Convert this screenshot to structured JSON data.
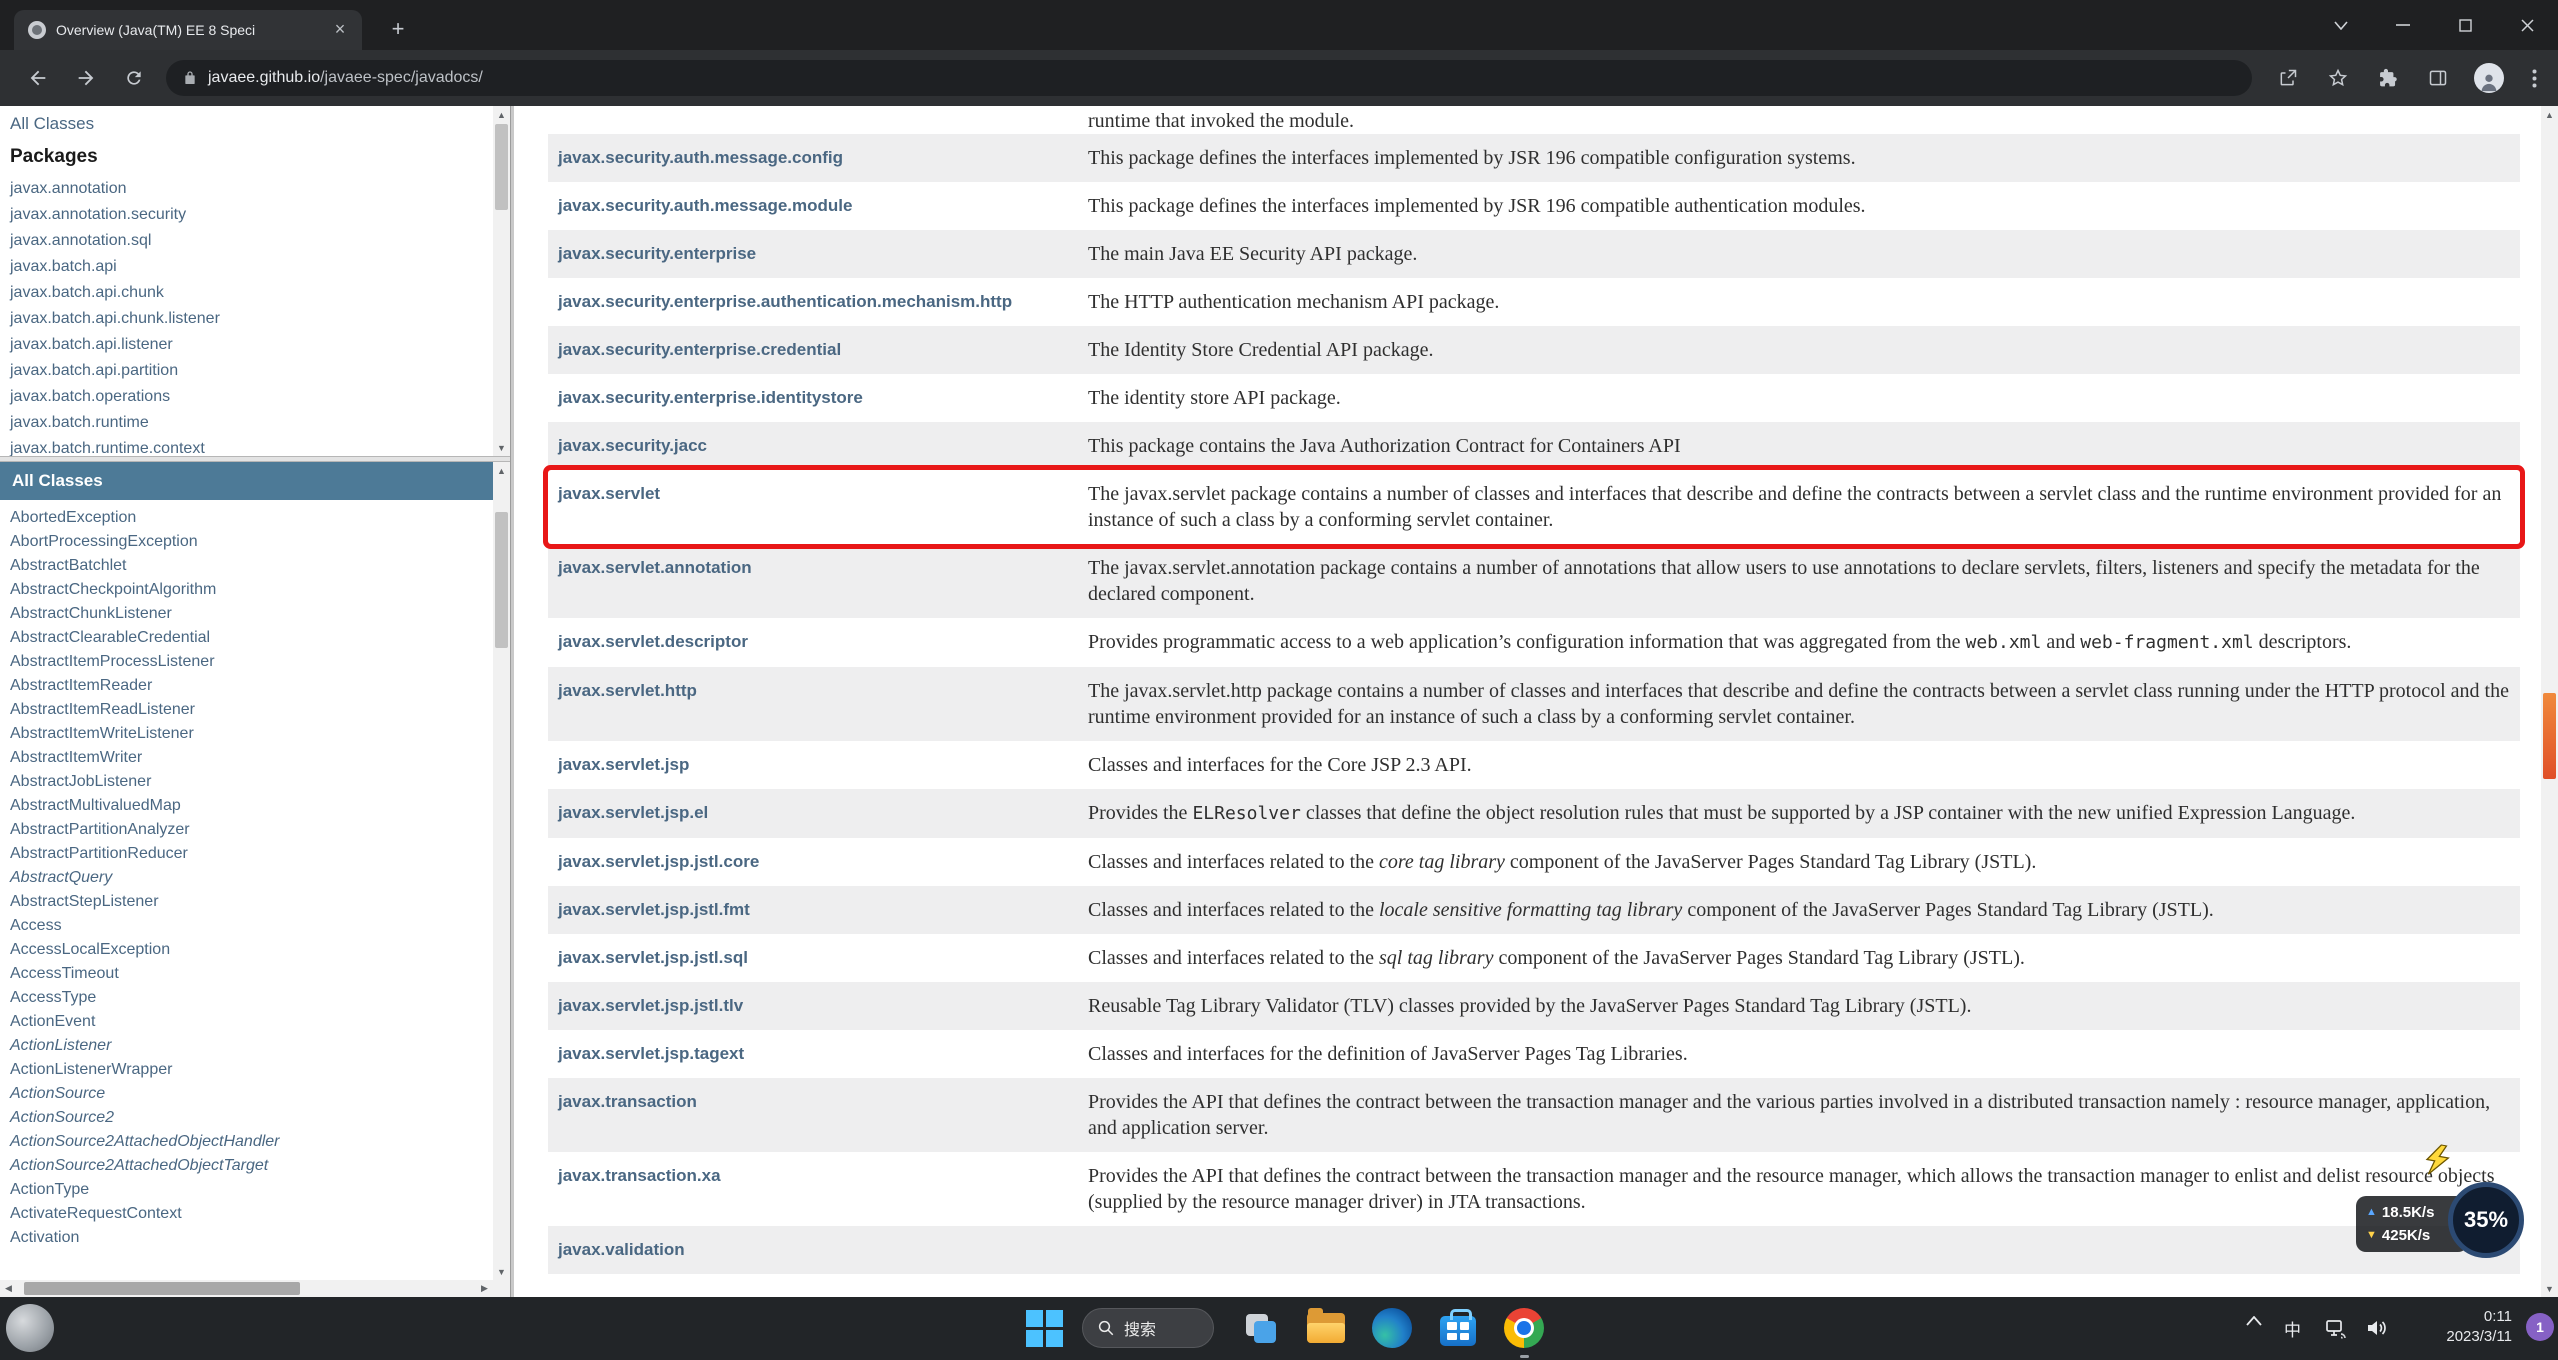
{
  "browser": {
    "tab_title": "Overview (Java(TM) EE 8 Speci",
    "url_domain": "javaee.github.io",
    "url_path": "/javaee-spec/javadocs/"
  },
  "sidebar": {
    "all_classes_link": "All Classes",
    "packages_header": "Packages",
    "packages": [
      "javax.annotation",
      "javax.annotation.security",
      "javax.annotation.sql",
      "javax.batch.api",
      "javax.batch.api.chunk",
      "javax.batch.api.chunk.listener",
      "javax.batch.api.listener",
      "javax.batch.api.partition",
      "javax.batch.operations",
      "javax.batch.runtime",
      "javax.batch.runtime.context"
    ],
    "classes_header": "All Classes",
    "classes": [
      {
        "n": "AbortedException"
      },
      {
        "n": "AbortProcessingException"
      },
      {
        "n": "AbstractBatchlet"
      },
      {
        "n": "AbstractCheckpointAlgorithm"
      },
      {
        "n": "AbstractChunkListener"
      },
      {
        "n": "AbstractClearableCredential"
      },
      {
        "n": "AbstractItemProcessListener"
      },
      {
        "n": "AbstractItemReader"
      },
      {
        "n": "AbstractItemReadListener"
      },
      {
        "n": "AbstractItemWriteListener"
      },
      {
        "n": "AbstractItemWriter"
      },
      {
        "n": "AbstractJobListener"
      },
      {
        "n": "AbstractMultivaluedMap"
      },
      {
        "n": "AbstractPartitionAnalyzer"
      },
      {
        "n": "AbstractPartitionReducer"
      },
      {
        "n": "AbstractQuery",
        "i": 1
      },
      {
        "n": "AbstractStepListener"
      },
      {
        "n": "Access"
      },
      {
        "n": "AccessLocalException"
      },
      {
        "n": "AccessTimeout"
      },
      {
        "n": "AccessType"
      },
      {
        "n": "ActionEvent"
      },
      {
        "n": "ActionListener",
        "i": 1
      },
      {
        "n": "ActionListenerWrapper"
      },
      {
        "n": "ActionSource",
        "i": 1
      },
      {
        "n": "ActionSource2",
        "i": 1
      },
      {
        "n": "ActionSource2AttachedObjectHandler",
        "i": 1
      },
      {
        "n": "ActionSource2AttachedObjectTarget",
        "i": 1
      },
      {
        "n": "ActionType"
      },
      {
        "n": "ActivateRequestContext"
      },
      {
        "n": "Activation"
      }
    ]
  },
  "main": {
    "rows": [
      {
        "pkg": "",
        "desc": "runtime that invoked the module.",
        "partial": 1
      },
      {
        "pkg": "javax.security.auth.message.config",
        "desc": "This package defines the interfaces implemented by JSR 196 compatible configuration systems."
      },
      {
        "pkg": "javax.security.auth.message.module",
        "desc": "This package defines the interfaces implemented by JSR 196 compatible authentication modules."
      },
      {
        "pkg": "javax.security.enterprise",
        "desc": "The main Java EE Security API package."
      },
      {
        "pkg": "javax.security.enterprise.authentication.mechanism.http",
        "desc": "The HTTP authentication mechanism API package."
      },
      {
        "pkg": "javax.security.enterprise.credential",
        "desc": "The Identity Store Credential API package."
      },
      {
        "pkg": "javax.security.enterprise.identitystore",
        "desc": "The identity store API package."
      },
      {
        "pkg": "javax.security.jacc",
        "desc": "This package contains the Java Authorization Contract for Containers API"
      },
      {
        "pkg": "javax.servlet",
        "highlight": 1,
        "desc": "The javax.servlet package contains a number of classes and interfaces that describe and define the contracts between a servlet class and the runtime environment provided for an instance of such a class by a conforming servlet container."
      },
      {
        "pkg": "javax.servlet.annotation",
        "desc": "The javax.servlet.annotation package contains a number of annotations that allow users to use annotations to declare servlets, filters, listeners and specify the metadata for the declared component."
      },
      {
        "pkg": "javax.servlet.descriptor",
        "desc": [
          {
            "t": "Provides programmatic access to a web application’s configuration information that was aggregated from the "
          },
          {
            "t": "web.xml",
            "s": "code"
          },
          {
            "t": " and "
          },
          {
            "t": "web-fragment.xml",
            "s": "code"
          },
          {
            "t": " descriptors."
          }
        ]
      },
      {
        "pkg": "javax.servlet.http",
        "desc": "The javax.servlet.http package contains a number of classes and interfaces that describe and define the contracts between a servlet class running under the HTTP protocol and the runtime environment provided for an instance of such a class by a conforming servlet container."
      },
      {
        "pkg": "javax.servlet.jsp",
        "desc": "Classes and interfaces for the Core JSP 2.3 API."
      },
      {
        "pkg": "javax.servlet.jsp.el",
        "desc": [
          {
            "t": "Provides the "
          },
          {
            "t": "ELResolver",
            "s": "code"
          },
          {
            "t": " classes that define the object resolution rules that must be supported by a JSP container with the new unified Expression Language."
          }
        ]
      },
      {
        "pkg": "javax.servlet.jsp.jstl.core",
        "desc": [
          {
            "t": "Classes and interfaces related to the "
          },
          {
            "t": "core tag library",
            "s": "i"
          },
          {
            "t": " component of the JavaServer Pages Standard Tag Library (JSTL)."
          }
        ]
      },
      {
        "pkg": "javax.servlet.jsp.jstl.fmt",
        "desc": [
          {
            "t": "Classes and interfaces related to the "
          },
          {
            "t": "locale sensitive formatting tag library",
            "s": "i"
          },
          {
            "t": " component of the JavaServer Pages Standard Tag Library (JSTL)."
          }
        ]
      },
      {
        "pkg": "javax.servlet.jsp.jstl.sql",
        "desc": [
          {
            "t": "Classes and interfaces related to the "
          },
          {
            "t": "sql tag library",
            "s": "i"
          },
          {
            "t": " component of the JavaServer Pages Standard Tag Library (JSTL)."
          }
        ]
      },
      {
        "pkg": "javax.servlet.jsp.jstl.tlv",
        "desc": "Reusable Tag Library Validator (TLV) classes provided by the JavaServer Pages Standard Tag Library (JSTL)."
      },
      {
        "pkg": "javax.servlet.jsp.tagext",
        "desc": "Classes and interfaces for the definition of JavaServer Pages Tag Libraries."
      },
      {
        "pkg": "javax.transaction",
        "desc": "Provides the API that defines the contract between the transaction manager and the various parties involved in a distributed transaction namely : resource manager, application, and application server."
      },
      {
        "pkg": "javax.transaction.xa",
        "desc": "Provides the API that defines the contract between the transaction manager and the resource manager, which allows the transaction manager to enlist and delist resource objects (supplied by the resource manager driver) in JTA transactions."
      },
      {
        "pkg": "javax.validation",
        "desc": ""
      }
    ]
  },
  "overlay": {
    "upload": "18.5K/s",
    "download": "425K/s",
    "percent": "35%"
  },
  "taskbar": {
    "search_label": "搜索",
    "ime_label": "中",
    "time": "0:11",
    "date": "2023/3/11",
    "badge_count": "1"
  }
}
